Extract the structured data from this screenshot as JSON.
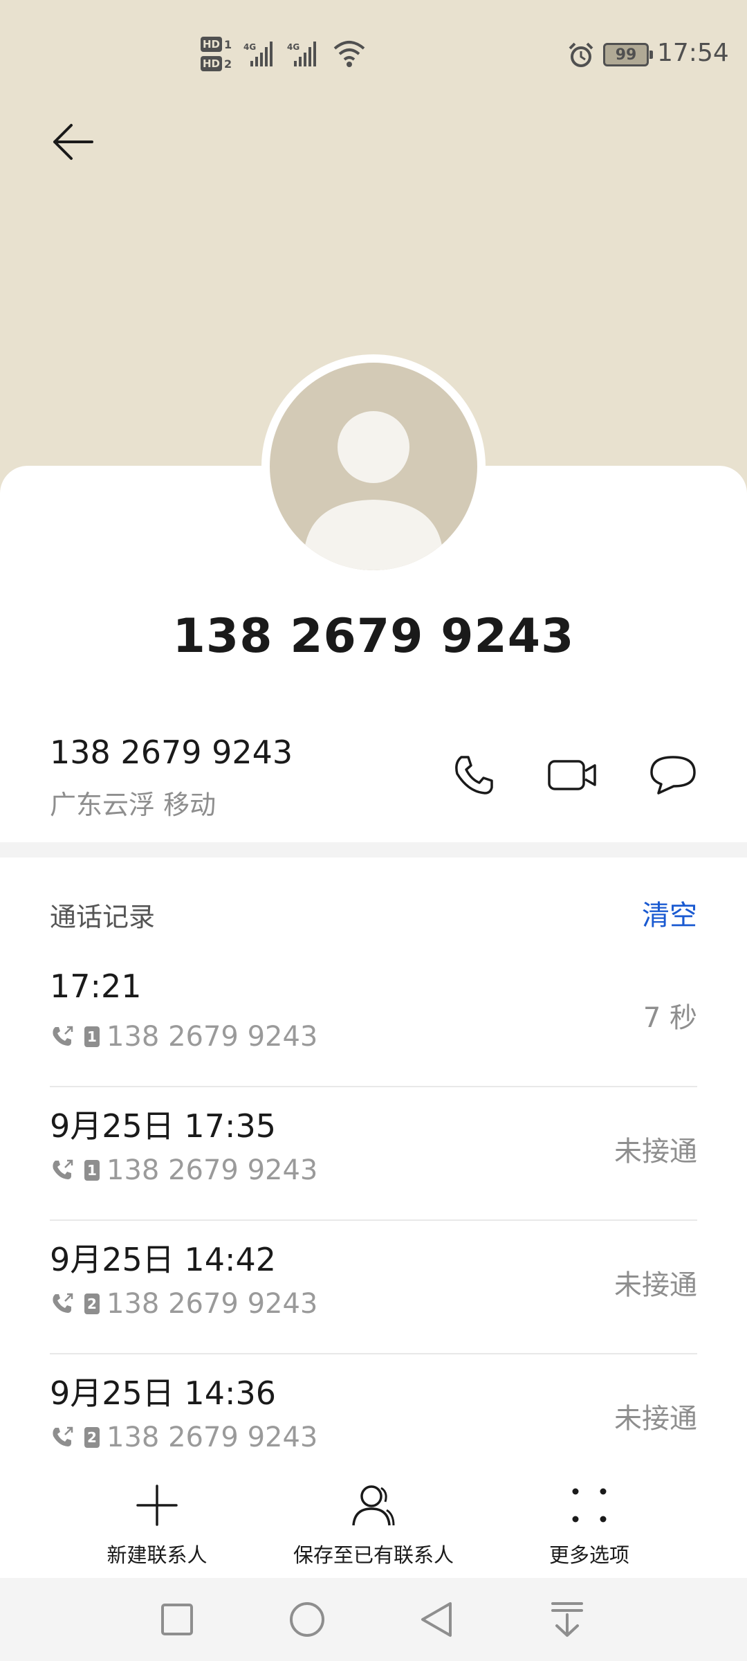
{
  "status_bar": {
    "sim1_label": "HD",
    "sim1_num": "1",
    "sim2_label": "HD",
    "sim2_num": "2",
    "battery": "99",
    "time": "17:54"
  },
  "contact": {
    "name": "138 2679 9243",
    "number": "138 2679 9243",
    "location": "广东云浮 移动"
  },
  "call_log": {
    "title": "通话记录",
    "clear_label": "清空",
    "entries": [
      {
        "time": "17:21",
        "sim": "1",
        "number": "138 2679 9243",
        "status": "7 秒"
      },
      {
        "time": "9月25日 17:35",
        "sim": "1",
        "number": "138 2679 9243",
        "status": "未接通"
      },
      {
        "time": "9月25日 14:42",
        "sim": "2",
        "number": "138 2679 9243",
        "status": "未接通"
      },
      {
        "time": "9月25日 14:36",
        "sim": "2",
        "number": "138 2679 9243",
        "status": "未接通"
      }
    ]
  },
  "bottom_actions": {
    "new_contact": "新建联系人",
    "save_existing": "保存至已有联系人",
    "more_options": "更多选项"
  },
  "colors": {
    "header_bg": "#e8e1cf",
    "accent": "#1a5ad1",
    "avatar_bg": "#d3cab6"
  }
}
